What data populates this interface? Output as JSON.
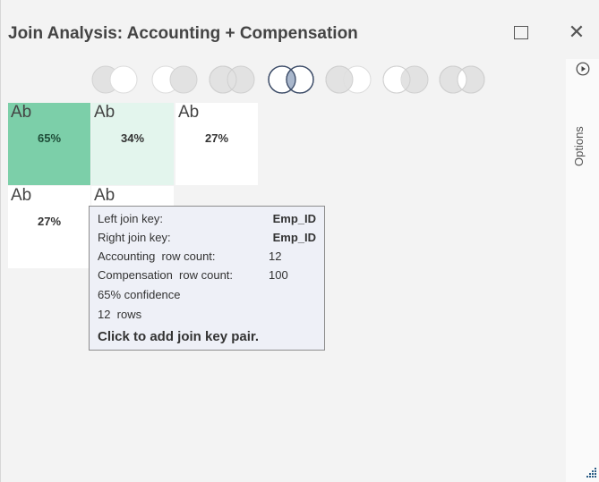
{
  "window": {
    "title": "Join Analysis: Accounting + Compensation",
    "maximize_label": "Maximize",
    "close_glyph": "✕"
  },
  "side_panel": {
    "label": "Options",
    "icon": "play-circle-icon"
  },
  "join_types": [
    {
      "name": "left-exclusive"
    },
    {
      "name": "right-exclusive"
    },
    {
      "name": "full-outer"
    },
    {
      "name": "inner",
      "selected": true
    },
    {
      "name": "left-outer"
    },
    {
      "name": "right-outer"
    },
    {
      "name": "full-exclusive"
    }
  ],
  "tiles": [
    {
      "label": "Ab",
      "percent": "65%"
    },
    {
      "label": "Ab",
      "percent": "34%"
    },
    {
      "label": "Ab",
      "percent": "27%"
    },
    {
      "label": "Ab",
      "percent": "27%"
    },
    {
      "label": "Ab",
      "percent": ""
    }
  ],
  "tooltip": {
    "left_key_label": "Left join key:",
    "left_key_value": "Emp_ID",
    "right_key_label": "Right join key:",
    "right_key_value": "Emp_ID",
    "left_count_label": "Accounting  row count:",
    "left_count_value": "12",
    "right_count_label": "Compensation  row count:",
    "right_count_value": "100",
    "confidence": "65% confidence",
    "rows": "12  rows",
    "cta": "Click to add join key pair."
  },
  "colors": {
    "tile_high": "#7ccfa9",
    "tile_medium": "#e3f5ed",
    "tile_low": "#ffffff",
    "venn_fill": "#e2e2e2",
    "venn_selected": "#a9b7cc"
  }
}
